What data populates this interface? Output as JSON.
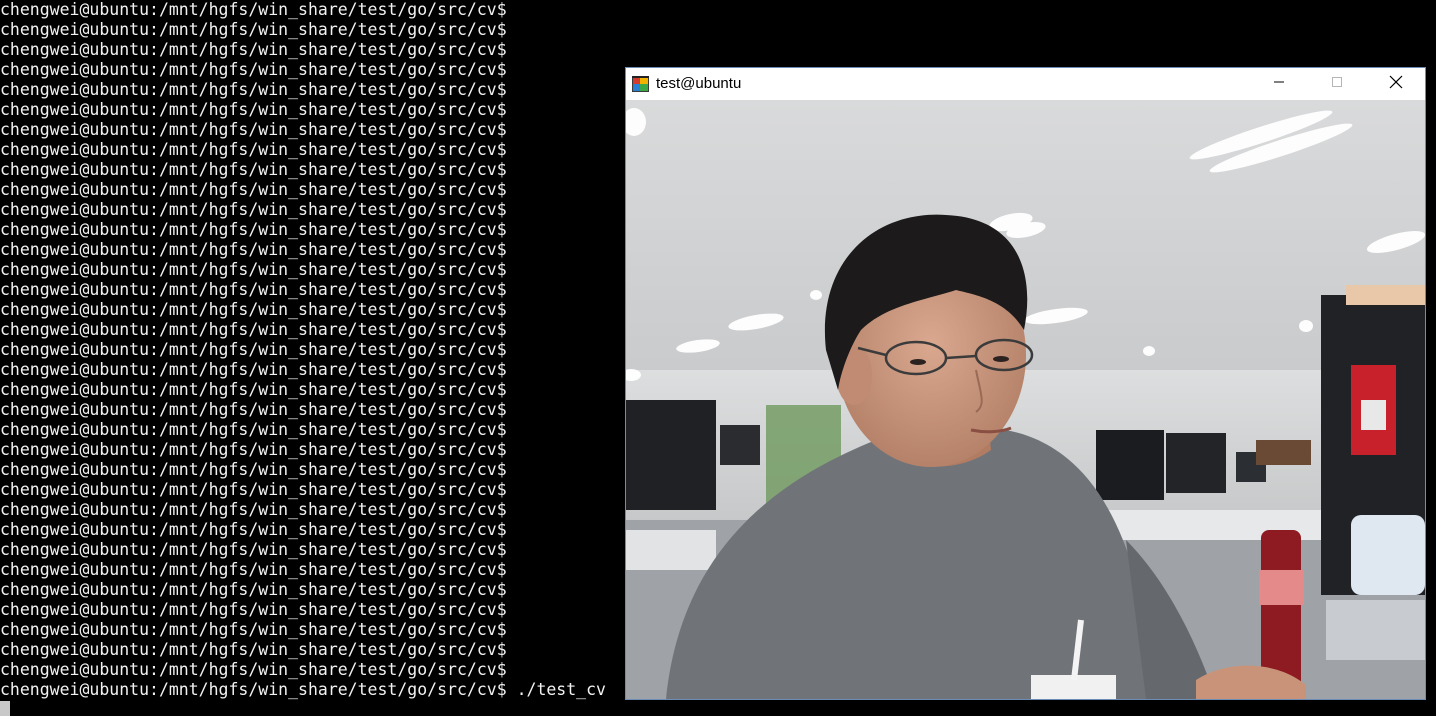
{
  "terminal": {
    "prompt": "chengwei@ubuntu:/mnt/hgfs/win_share/test/go/src/cv$",
    "repeated_prompt_lines": 34,
    "last_command": " ./test_cv"
  },
  "window": {
    "title": "test@ubuntu",
    "controls": {
      "minimize": "minimize-icon",
      "maximize": "maximize-icon",
      "close": "close-icon"
    },
    "border_color": "#6c8db5"
  },
  "camera_view": {
    "icon": "webcam-frame"
  },
  "colors": {
    "terminal_bg": "#000000",
    "terminal_fg": "#f2f2f2",
    "titlebar_bg": "#ffffff"
  }
}
